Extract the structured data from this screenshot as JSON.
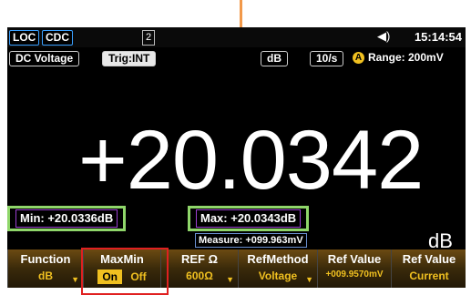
{
  "status": {
    "loc": "LOC",
    "cdc": "CDC",
    "slot": "2",
    "speaker": "◀)",
    "time": "15:14:54"
  },
  "modebar": {
    "function": "DC Voltage",
    "trigger": "Trig:INT",
    "math": "dB",
    "rate": "10/s",
    "auto": "A",
    "range": "Range: 200mV"
  },
  "reading": {
    "value": "+20.0342",
    "unit": "dB",
    "min": "Min: +20.0336dB",
    "max": "Max: +20.0343dB",
    "measure": "Measure: +099.963mV"
  },
  "softkeys": [
    {
      "title": "Function",
      "value": "dB"
    },
    {
      "title": "MaxMin",
      "value_on": "On",
      "value_off": "Off"
    },
    {
      "title": "REF Ω",
      "value": "600Ω"
    },
    {
      "title": "RefMethod",
      "value": "Voltage"
    },
    {
      "title": "Ref Value",
      "value": "+009.9570mV"
    },
    {
      "title": "Ref Value",
      "value": "Current"
    }
  ],
  "colors": {
    "callout": "#f2994a",
    "highlight_green": "#8fd66a",
    "highlight_red": "#e02020",
    "softkey_accent": "#f0c020"
  }
}
